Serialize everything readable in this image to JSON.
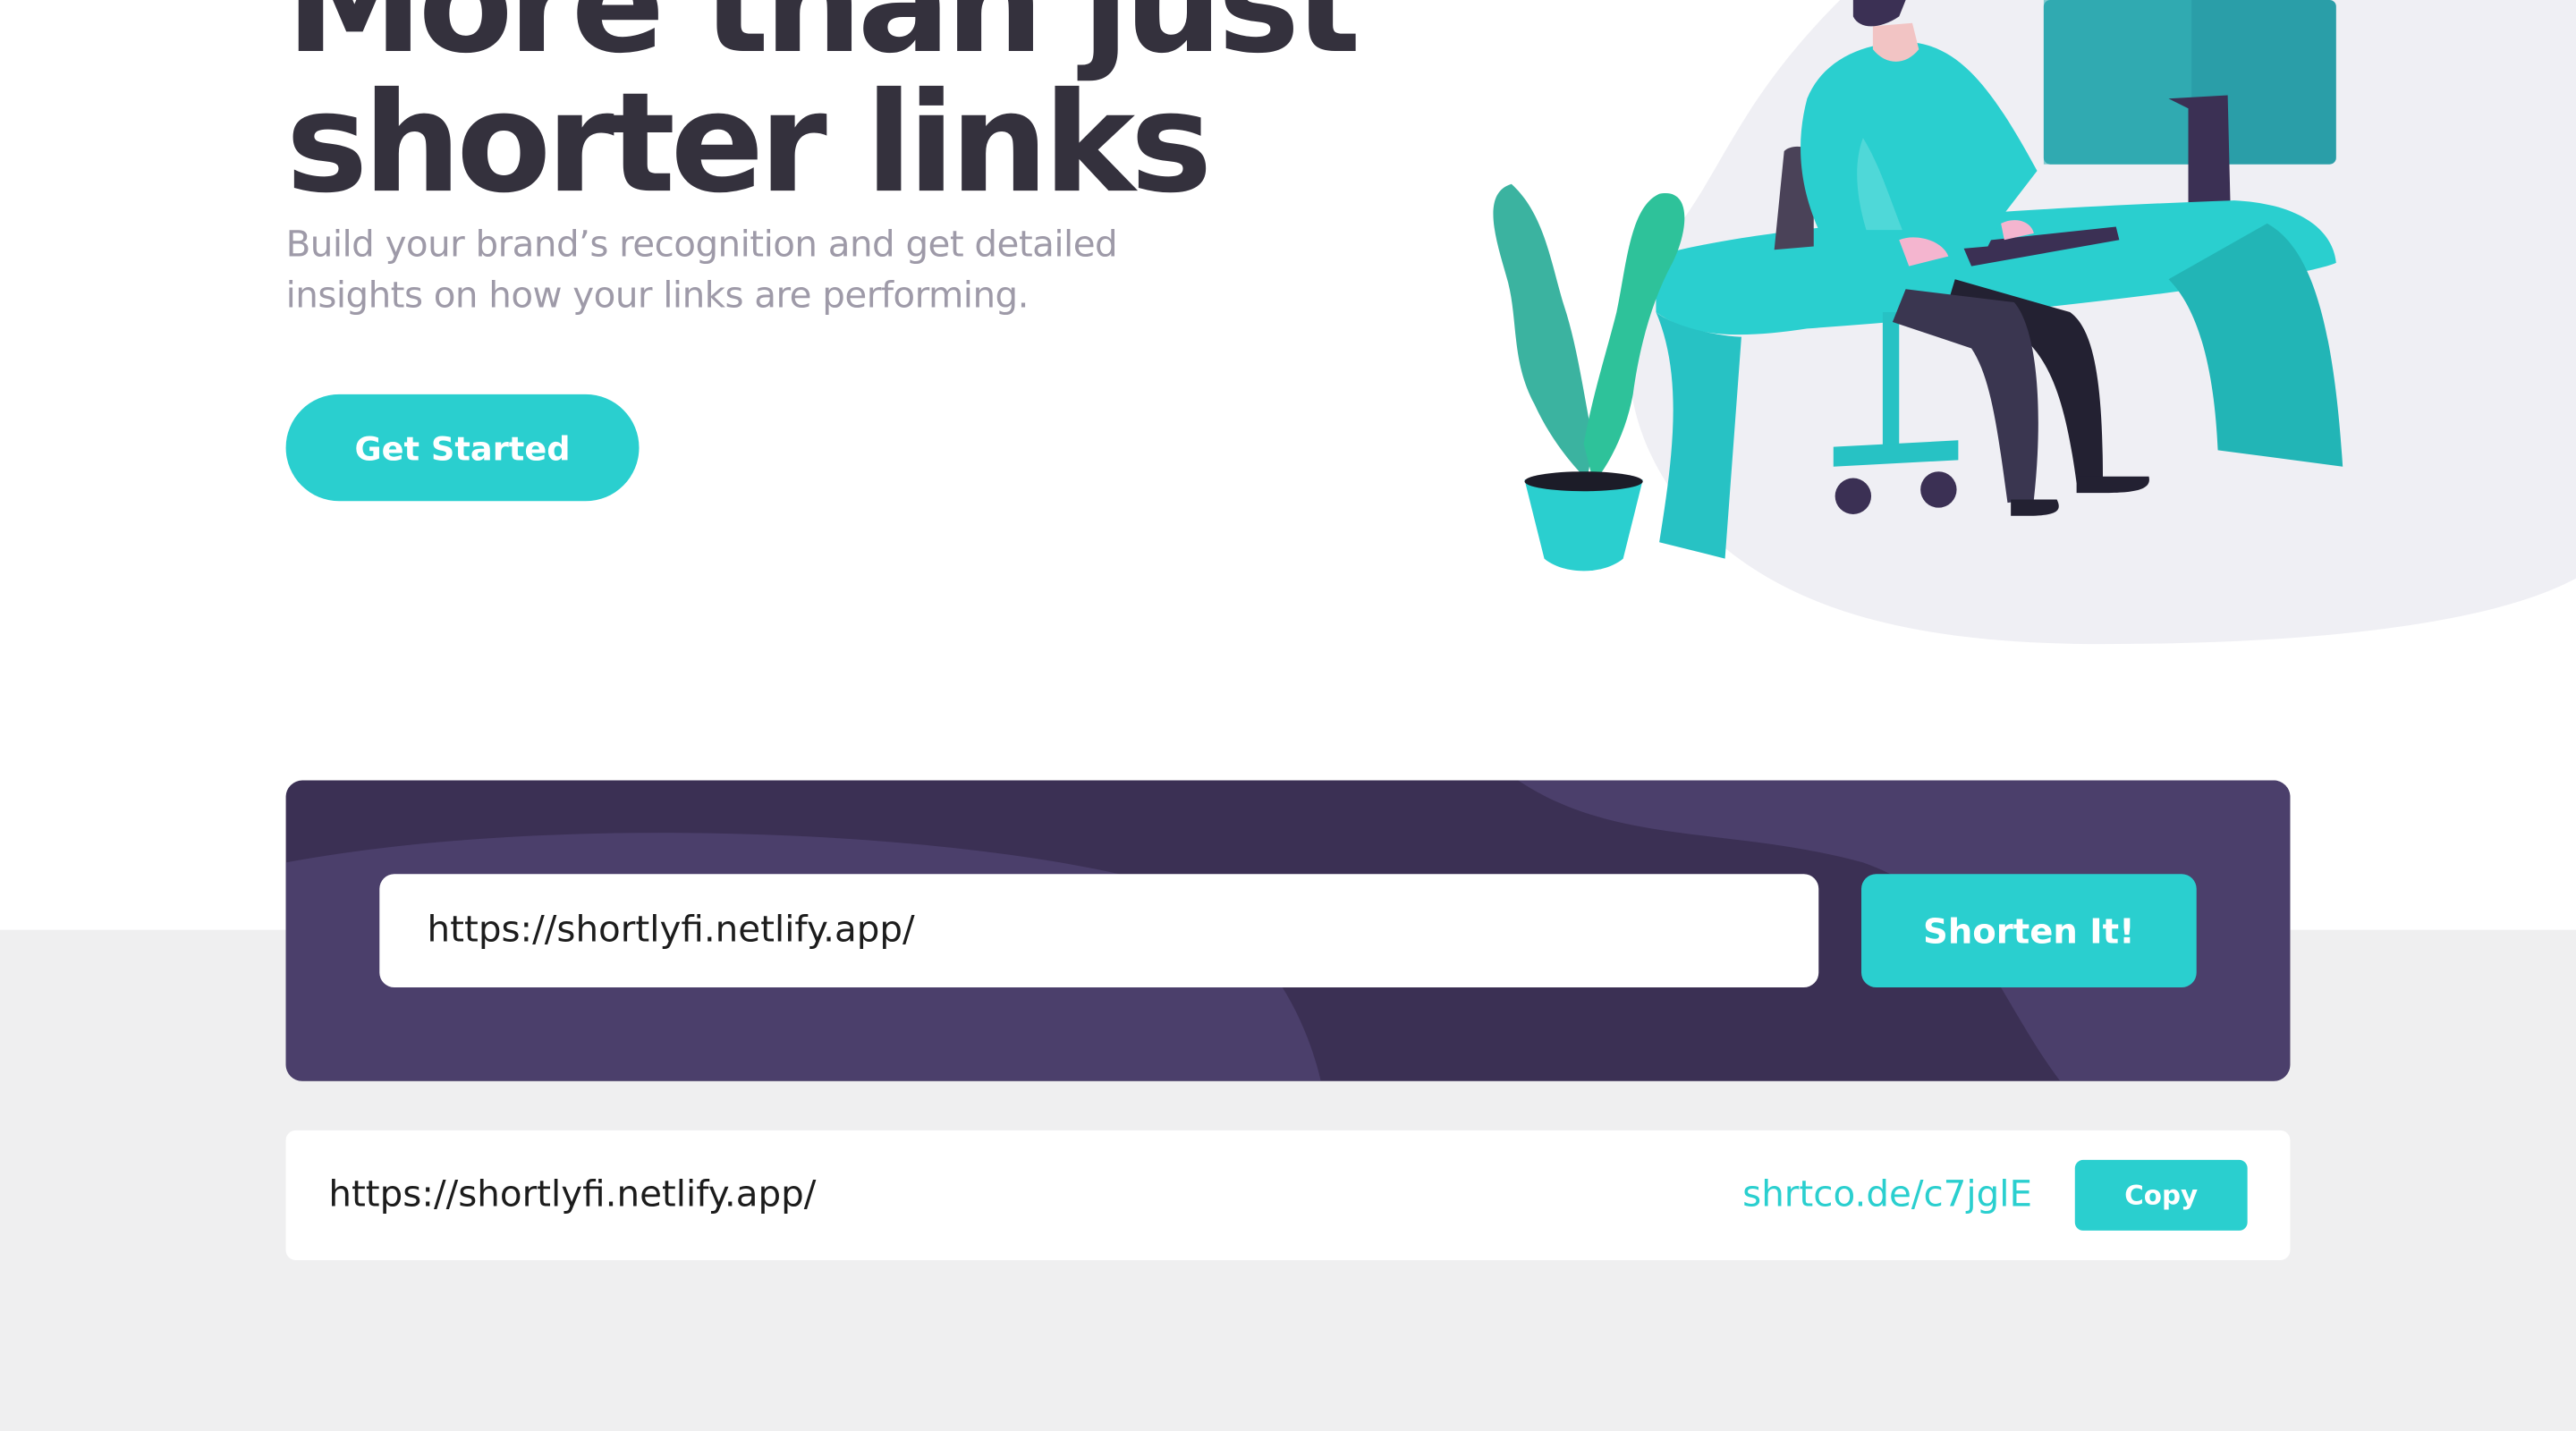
{
  "hero": {
    "title_line1": "More than just",
    "title_line2": "shorter links",
    "subtitle": "Build your brand’s recognition and get detailed insights on how your links are performing.",
    "cta_label": "Get Started"
  },
  "shortener": {
    "input_value": "https://shortlyfi.netlify.app/",
    "button_label": "Shorten It!"
  },
  "results": [
    {
      "original": "https://shortlyfi.netlify.app/",
      "short": "shrtco.de/c7jglE",
      "copy_label": "Copy"
    }
  ],
  "colors": {
    "accent": "#2acfcf",
    "dark_violet": "#3b3054",
    "heading": "#34313d",
    "muted_text": "#9e9aa8",
    "section_bg": "#efeff0"
  },
  "illustration": {
    "icon": "person-working-at-desk-illustration"
  }
}
